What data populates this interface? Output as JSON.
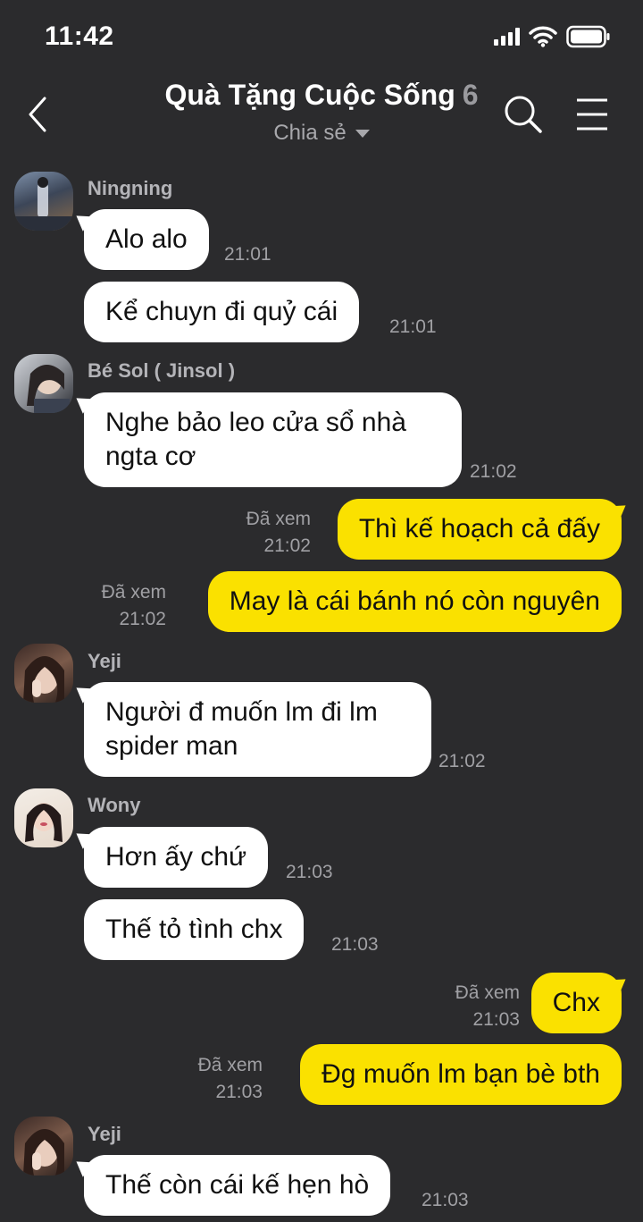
{
  "status": {
    "time": "11:42"
  },
  "header": {
    "title": "Quà Tặng Cuộc Sống",
    "member_count": "6",
    "subtitle": "Chia sẻ"
  },
  "messages": [
    {
      "sender": "Ningning",
      "text": "Alo alo",
      "time": "21:01"
    },
    {
      "text": "Kể chuyn đi quỷ cái",
      "time": "21:01"
    },
    {
      "sender": "Bé Sol ( Jinsol )",
      "text": "Nghe bảo leo cửa sổ nhà ngta cơ",
      "time": "21:02"
    },
    {
      "text": "Thì kế hoạch cả đấy",
      "seen": "Đã xem",
      "time": "21:02"
    },
    {
      "text": "May là cái bánh nó còn nguyên",
      "seen": "Đã xem",
      "time": "21:02"
    },
    {
      "sender": "Yeji",
      "text": "Người đ muốn lm đi lm spider man",
      "time": "21:02"
    },
    {
      "sender": "Wony",
      "text": "Hơn ấy chứ",
      "time": "21:03"
    },
    {
      "text": "Thế tỏ tình chx",
      "time": "21:03"
    },
    {
      "text": "Chx",
      "seen": "Đã xem",
      "time": "21:03"
    },
    {
      "text": "Đg muốn lm bạn bè bth",
      "seen": "Đã xem",
      "time": "21:03"
    },
    {
      "sender": "Yeji",
      "text": "Thế còn cái kế hẹn hò",
      "time": "21:03"
    }
  ],
  "colors": {
    "background": "#2b2b2d",
    "outgoing": "#fae100",
    "incoming": "#ffffff"
  }
}
